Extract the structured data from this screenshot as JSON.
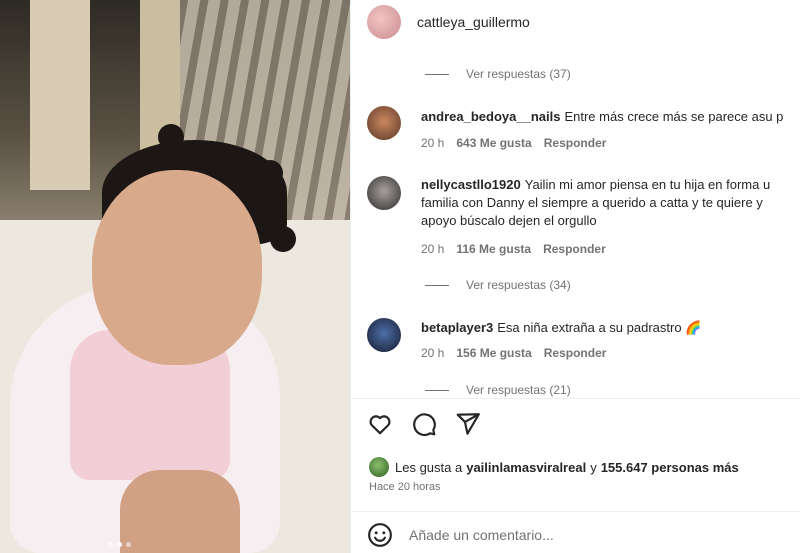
{
  "header": {
    "username": "cattleya_guillermo"
  },
  "comments": [
    {
      "replies_label_before": "Ver respuestas (37)",
      "username": "andrea_bedoya__nails",
      "text": "Entre más crece más se parece asu p",
      "time": "20 h",
      "likes": "643 Me gusta",
      "reply": "Responder"
    },
    {
      "username": "nellycastllo1920",
      "text": "Yailin mi amor piensa en tu hija en forma u\nfamilia con Danny el siempre a querido a catta y te quiere y\napoyo búscalo dejen el orgullo",
      "time": "20 h",
      "likes": "116 Me gusta",
      "reply": "Responder",
      "replies_label_after": "Ver respuestas (34)"
    },
    {
      "username": "betaplayer3",
      "text": "Esa niña extraña a su padrastro 🌈",
      "time": "20 h",
      "likes": "156 Me gusta",
      "reply": "Responder",
      "replies_label_after": "Ver respuestas (21)"
    }
  ],
  "actions": {
    "like_icon": "heart-icon",
    "comment_icon": "comment-icon",
    "share_icon": "send-icon"
  },
  "likes_line": {
    "prefix": "Les gusta a",
    "user": "yailinlamasviralreal",
    "conj": "y",
    "count": "155.647 personas más"
  },
  "posted": "Hace 20 horas",
  "add_comment": {
    "placeholder": "Añade un comentario...",
    "emoji_icon": "emoji-icon"
  },
  "carousel": {
    "total": 3,
    "active": 1
  }
}
